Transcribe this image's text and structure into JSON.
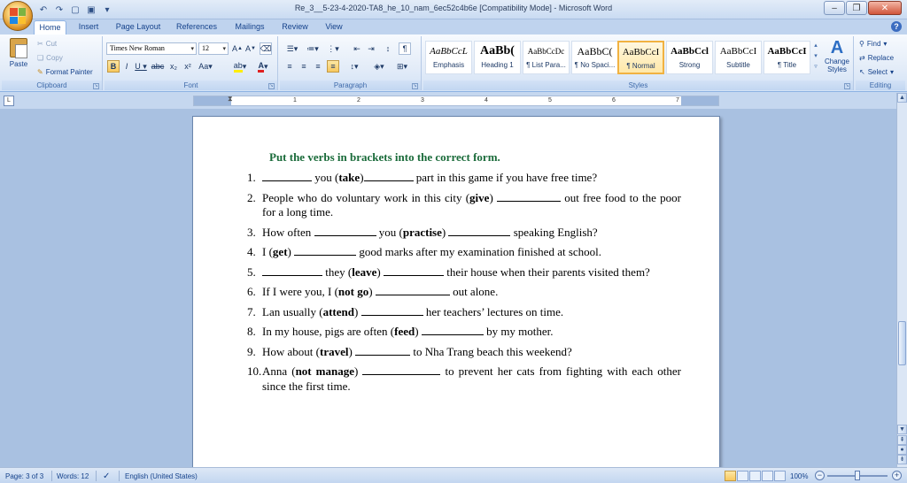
{
  "window": {
    "title": "Re_3__5-23-4-2020-TA8_he_10_nam_6ec52c4b6e [Compatibility Mode] - Microsoft Word"
  },
  "tabs": [
    "Home",
    "Insert",
    "Page Layout",
    "References",
    "Mailings",
    "Review",
    "View"
  ],
  "ribbon": {
    "clipboard": {
      "paste": "Paste",
      "cut": "Cut",
      "copy": "Copy",
      "format_painter": "Format Painter",
      "label": "Clipboard"
    },
    "font": {
      "family": "Times New Roman",
      "size": "12",
      "label": "Font"
    },
    "paragraph": {
      "label": "Paragraph"
    },
    "styles": {
      "label": "Styles",
      "items": [
        {
          "sample": "AaBbCcL",
          "name": "Emphasis"
        },
        {
          "sample": "AaBb(",
          "name": "Heading 1"
        },
        {
          "sample": "AaBbCcDc",
          "name": "¶ List Para..."
        },
        {
          "sample": "AaBbC(",
          "name": "¶ No Spaci..."
        },
        {
          "sample": "AaBbCcI",
          "name": "¶ Normal"
        },
        {
          "sample": "AaBbCcl",
          "name": "Strong"
        },
        {
          "sample": "AaBbCcI",
          "name": "Subtitle"
        },
        {
          "sample": "AaBbCcI",
          "name": "¶ Title"
        }
      ],
      "change_styles": "Change Styles"
    },
    "editing": {
      "find": "Find",
      "replace": "Replace",
      "select": "Select",
      "label": "Editing"
    }
  },
  "ruler": {
    "numbers": [
      "1",
      "2",
      "3",
      "4",
      "5",
      "6",
      "7"
    ]
  },
  "document": {
    "heading": "Put the verbs in brackets into the correct form.",
    "questions": [
      {
        "num": "1.",
        "html": "<span class=\"blank\" style=\"width:56px\"></span> you (<b>take</b>)<span class=\"blank\" style=\"width:56px\"></span> part in this game if you have free time?"
      },
      {
        "num": "2.",
        "html": "People who do voluntary work in this city (<b>give</b>) <span class=\"blank\" style=\"width:72px\"></span> out free food to the poor for a long time."
      },
      {
        "num": "3.",
        "html": "How often <span class=\"blank\" style=\"width:70px\"></span> you (<b>practise</b>) <span class=\"blank\" style=\"width:70px\"></span> speaking English?"
      },
      {
        "num": "4.",
        "html": "I (<b>get</b>) <span class=\"blank\" style=\"width:70px\"></span> good marks after my examination finished at school."
      },
      {
        "num": "5.",
        "html": "<span class=\"blank\" style=\"width:68px\"></span> they (<b>leave</b>) <span class=\"blank\" style=\"width:68px\"></span> their house when their parents visited them?"
      },
      {
        "num": "6.",
        "html": "If I were you, I (<b>not go</b>) <span class=\"blank\" style=\"width:84px\"></span> out alone."
      },
      {
        "num": "7.",
        "html": "Lan usually (<b>attend</b>) <span class=\"blank\" style=\"width:70px\"></span> her teachers’ lectures on time."
      },
      {
        "num": "8.",
        "html": "In my house, pigs are often (<b>feed</b>) <span class=\"blank\" style=\"width:70px\"></span> by my mother."
      },
      {
        "num": "9.",
        "html": "How about (<b>travel</b>) <span class=\"blank\" style=\"width:62px\"></span> to Nha Trang beach this weekend?"
      },
      {
        "num": "10.",
        "html": "Anna (<b>not manage</b>) <span class=\"blank\" style=\"width:88px\"></span> to prevent her cats from fighting with each other since the first time."
      }
    ]
  },
  "status": {
    "page": "Page: 3 of 3",
    "words": "Words: 12",
    "language": "English (United States)",
    "zoom": "100%"
  }
}
